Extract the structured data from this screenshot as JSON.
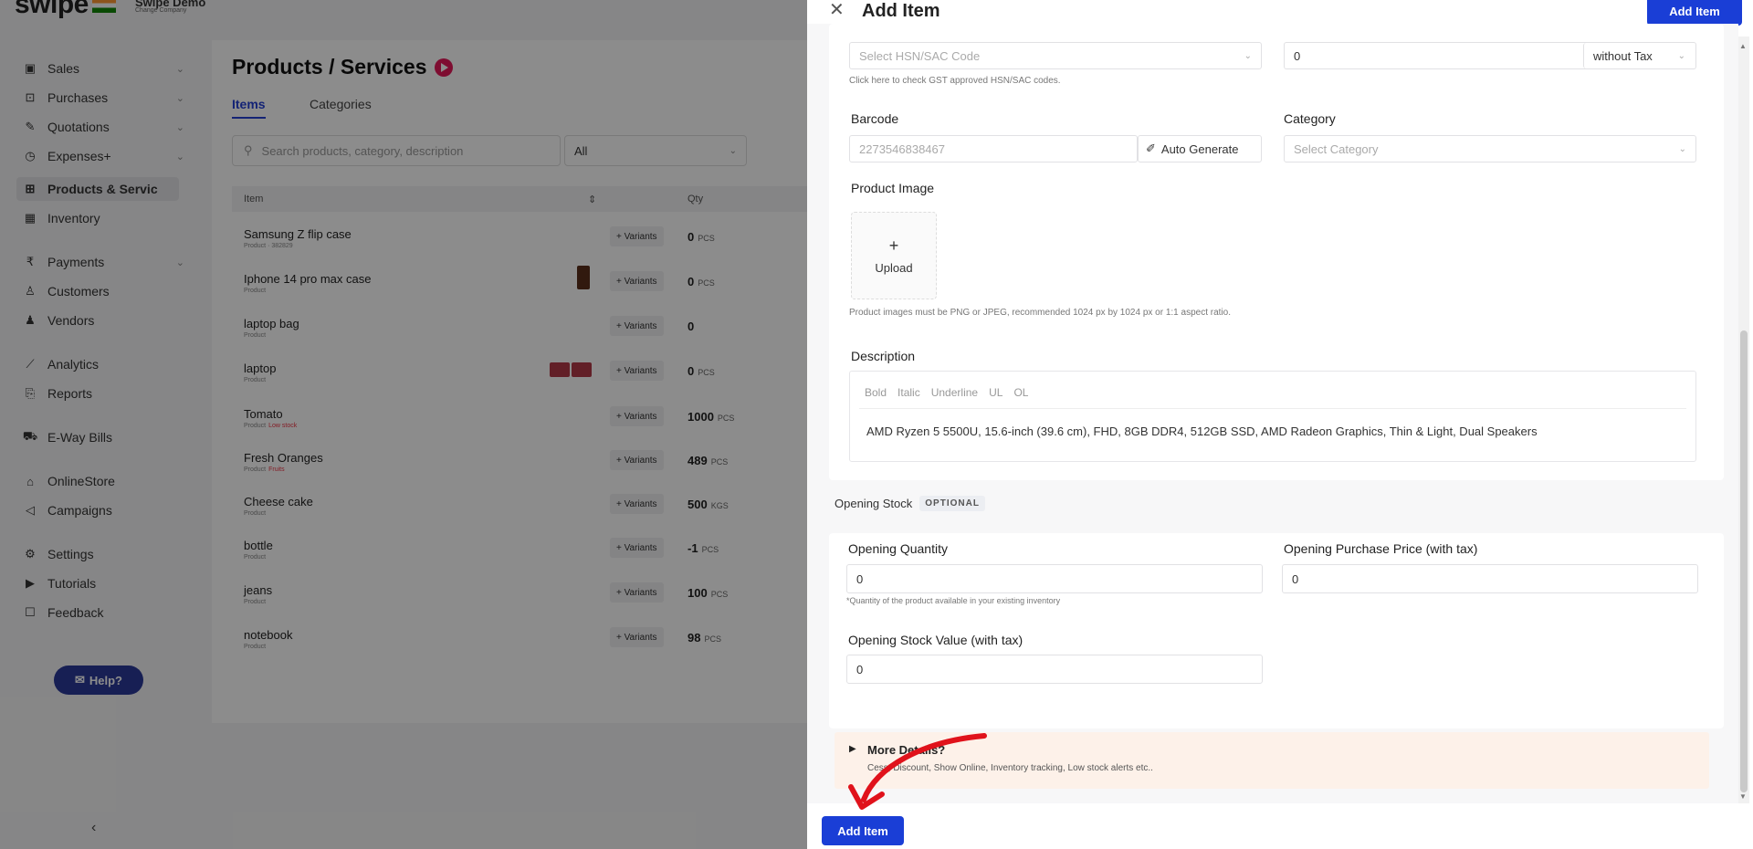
{
  "app": {
    "logo": "swipe",
    "company_name": "Swipe Demo",
    "company_sub": "Change Company"
  },
  "sidebar": {
    "items": [
      {
        "label": "Sales",
        "icon": "sales-icon"
      },
      {
        "label": "Purchases",
        "icon": "purchases-icon"
      },
      {
        "label": "Quotations",
        "icon": "quotations-icon"
      },
      {
        "label": "Expenses+",
        "icon": "expenses-icon"
      },
      {
        "label": "Products & Servic",
        "icon": "products-icon"
      },
      {
        "label": "Inventory",
        "icon": "inventory-icon"
      },
      {
        "label": "Payments",
        "icon": "rupee-icon"
      },
      {
        "label": "Customers",
        "icon": "customers-icon"
      },
      {
        "label": "Vendors",
        "icon": "vendors-icon"
      },
      {
        "label": "Analytics",
        "icon": "analytics-icon"
      },
      {
        "label": "Reports",
        "icon": "reports-icon"
      },
      {
        "label": "E-Way Bills",
        "icon": "truck-icon"
      },
      {
        "label": "OnlineStore",
        "icon": "store-icon"
      },
      {
        "label": "Campaigns",
        "icon": "megaphone-icon"
      },
      {
        "label": "Settings",
        "icon": "gear-icon"
      },
      {
        "label": "Tutorials",
        "icon": "youtube-icon"
      },
      {
        "label": "Feedback",
        "icon": "feedback-icon"
      }
    ],
    "help_label": "Help?"
  },
  "page": {
    "title": "Products / Services",
    "tabs": [
      "Items",
      "Categories"
    ],
    "search_placeholder": "Search products, category, description",
    "filter_value": "All",
    "columns": [
      "Item",
      "Qty"
    ],
    "variants_label": "+ Variants",
    "rows": [
      {
        "name": "Samsung Z flip case",
        "sub": "Product · 382829",
        "qty": "0",
        "unit": "PCS"
      },
      {
        "name": "Iphone 14 pro max case",
        "sub": "Product",
        "qty": "0",
        "unit": "PCS"
      },
      {
        "name": "laptop bag",
        "sub": "Product",
        "qty": "0",
        "unit": ""
      },
      {
        "name": "laptop",
        "sub": "Product",
        "qty": "0",
        "unit": "PCS"
      },
      {
        "name": "Tomato",
        "sub": "Product",
        "tag": "Low stock",
        "qty": "1000",
        "unit": "PCS"
      },
      {
        "name": "Fresh Oranges",
        "sub": "Product",
        "tag": "Fruits",
        "qty": "489",
        "unit": "PCS"
      },
      {
        "name": "Cheese cake",
        "sub": "Product",
        "qty": "500",
        "unit": "KGS"
      },
      {
        "name": "bottle",
        "sub": "Product",
        "qty": "-1",
        "unit": "PCS"
      },
      {
        "name": "jeans",
        "sub": "Product",
        "qty": "100",
        "unit": "PCS"
      },
      {
        "name": "notebook",
        "sub": "Product",
        "qty": "98",
        "unit": "PCS"
      }
    ]
  },
  "drawer": {
    "title": "Add Item",
    "add_label": "Add Item",
    "hsn_placeholder": "Select HSN/SAC Code",
    "hsn_hint": "Click here to check GST approved HSN/SAC codes.",
    "price_value": "0",
    "tax_mode": "without Tax",
    "barcode_label": "Barcode",
    "barcode_value": "2273546838467",
    "auto_generate_label": "Auto Generate",
    "category_label": "Category",
    "category_placeholder": "Select Category",
    "product_image_label": "Product Image",
    "upload_label": "Upload",
    "image_hint": "Product images must be PNG or JPEG, recommended 1024 px by 1024 px or 1:1 aspect ratio.",
    "description_label": "Description",
    "toolbar": [
      "Bold",
      "Italic",
      "Underline",
      "UL",
      "OL"
    ],
    "description_text": "AMD Ryzen 5 5500U, 15.6-inch (39.6 cm), FHD, 8GB DDR4, 512GB SSD, AMD Radeon Graphics, Thin & Light, Dual Speakers",
    "opening_stock_title": "Opening Stock",
    "optional_badge": "OPTIONAL",
    "opening_qty_label": "Opening Quantity",
    "opening_qty_value": "0",
    "opening_qty_hint": "*Quantity of the product available in your existing inventory",
    "opening_price_label": "Opening Purchase Price (with tax)",
    "opening_price_value": "0",
    "opening_value_label": "Opening Stock Value (with tax)",
    "opening_value_value": "0",
    "more_title": "More Details?",
    "more_sub": "Cess, Discount, Show Online, Inventory tracking, Low stock alerts etc.."
  },
  "colors": {
    "primary": "#1a3ed6",
    "annotation_arrow": "#e0121b",
    "more_bg": "#fdf1e9"
  }
}
